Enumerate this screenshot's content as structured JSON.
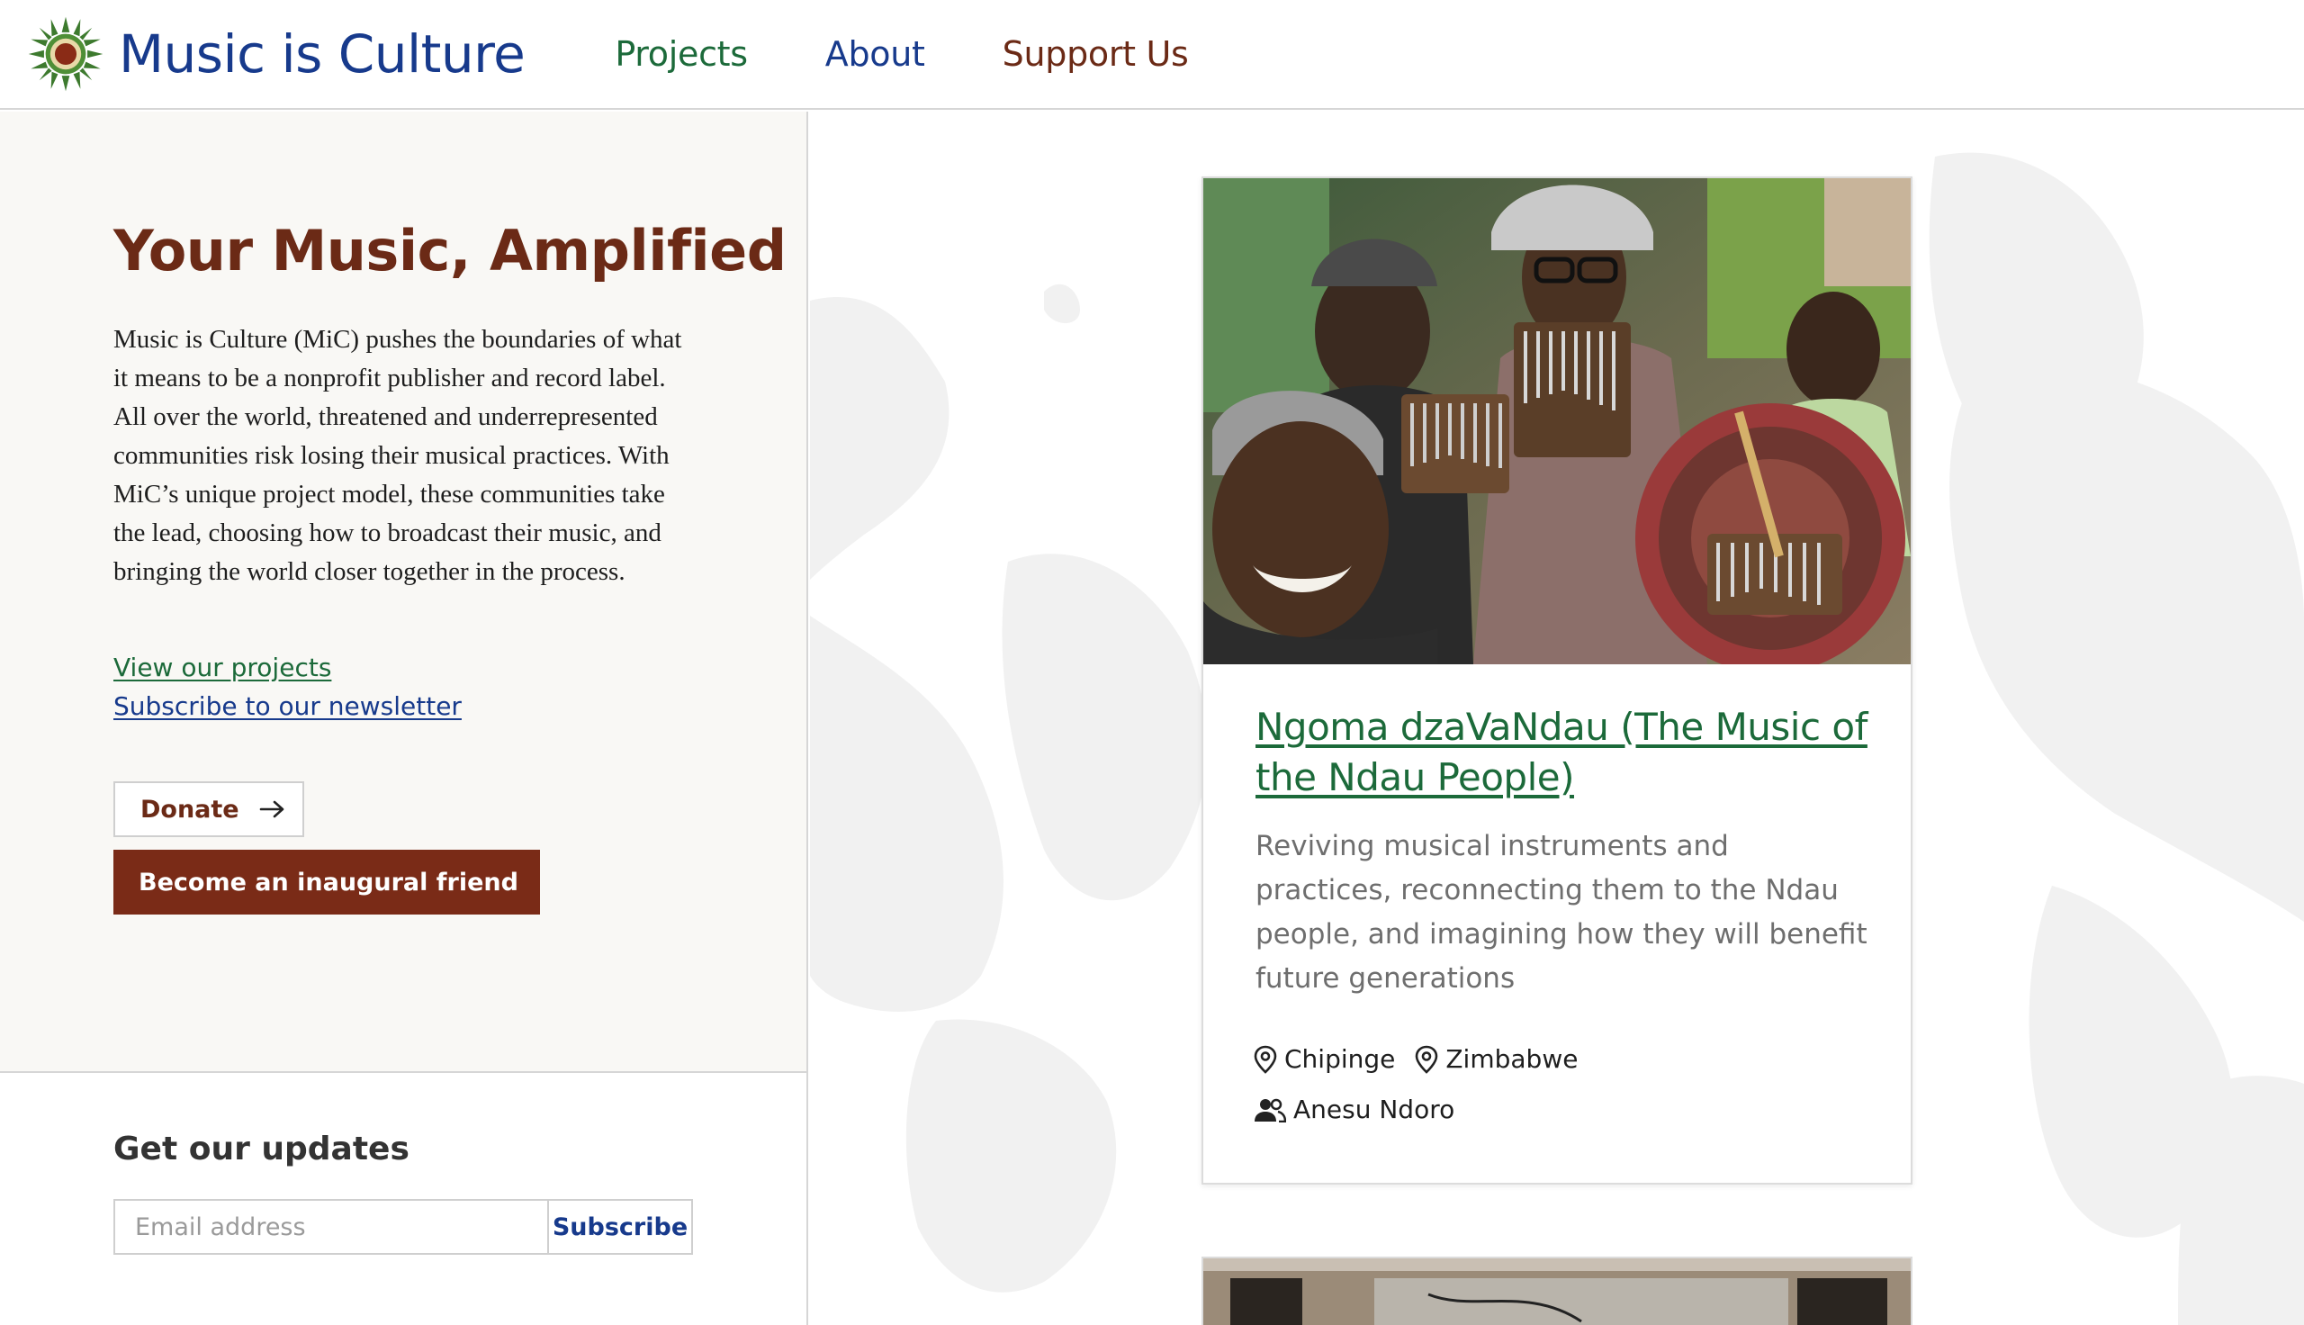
{
  "header": {
    "logo_text": "Music is Culture",
    "nav": [
      {
        "label": "Projects"
      },
      {
        "label": "About"
      },
      {
        "label": "Support Us"
      }
    ]
  },
  "hero": {
    "title": "Your Music, Amplified",
    "body": "Music is Culture (MiC) pushes the boundaries of what it means to be a nonprofit publisher and record label. All over the world, threatened and underrepresented communities risk losing their musical practices. With MiC’s unique project model, these communities take the lead, choosing how to broadcast their music, and bringing the world closer together in the process.",
    "link_projects": "View our projects",
    "link_newsletter": "Subscribe to our newsletter",
    "donate_label": "Donate",
    "friend_label": "Become an inaugural friend"
  },
  "updates": {
    "title": "Get our updates",
    "email_placeholder": "Email address",
    "subscribe_label": "Subscribe"
  },
  "project_card": {
    "title": "Ngoma dzaVaNdau (The Music of the Ndau People)",
    "description": "Reviving musical instruments and practices, reconnecting them to the Ndau people, and imagining how they will benefit future generations",
    "locations": [
      "Chipinge",
      "Zimbabwe"
    ],
    "person": "Anesu Ndoro"
  },
  "colors": {
    "brand_blue": "#173a8c",
    "brand_green": "#1c6a3a",
    "brand_brown": "#6b2a16",
    "button_brown": "#7a2b17"
  }
}
